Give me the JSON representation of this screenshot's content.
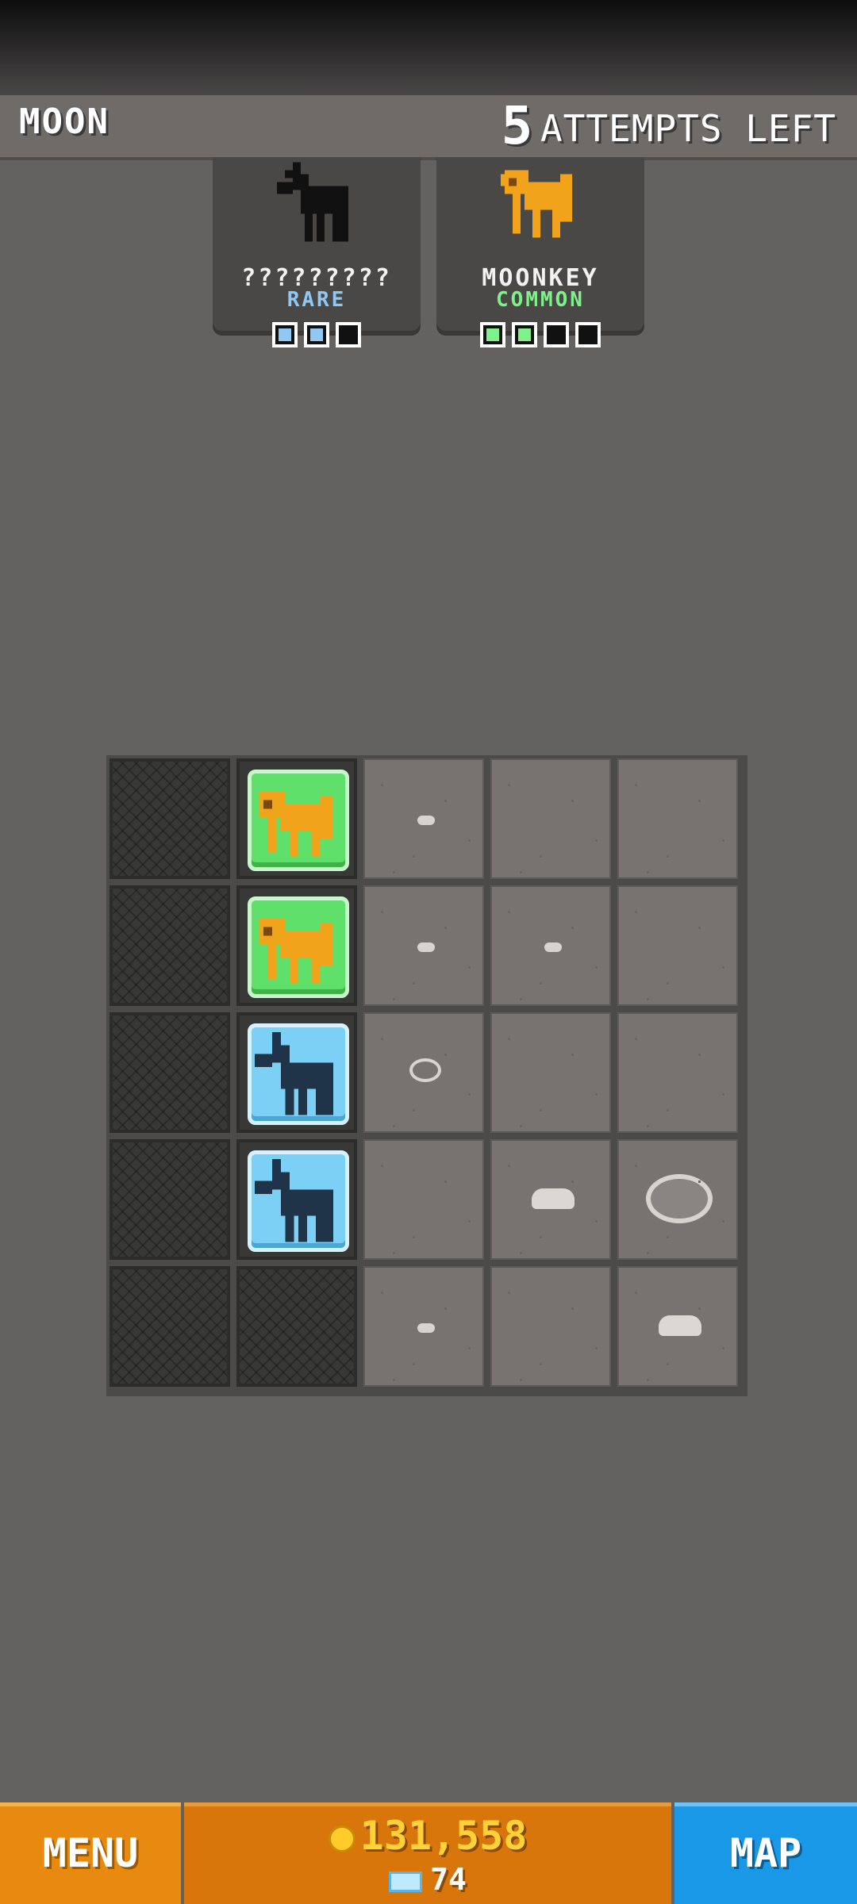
{
  "header": {
    "level_name": "MOON",
    "attempts_count": "5",
    "attempts_label": "ATTEMPTS LEFT"
  },
  "collection": {
    "cards": [
      {
        "name": "?????????",
        "rarity": "RARE",
        "rarity_color": "#8fc8f2",
        "found": 2,
        "total": 3,
        "icon": "moose-silhouette-icon"
      },
      {
        "name": "MOONKEY",
        "rarity": "COMMON",
        "rarity_color": "#7ef28a",
        "found": 2,
        "total": 4,
        "icon": "monkey-icon"
      }
    ]
  },
  "grid": {
    "rows": 5,
    "cols": 5,
    "cells": [
      [
        "dug",
        "moonkey",
        "pebble",
        "ground",
        "ground"
      ],
      [
        "dug",
        "moonkey",
        "pebble",
        "pebble",
        "ground"
      ],
      [
        "dug",
        "moose",
        "ring",
        "ground",
        "ground"
      ],
      [
        "dug",
        "moose",
        "ground",
        "rock",
        "crater"
      ],
      [
        "dug",
        "dug",
        "pebble",
        "ground",
        "rock"
      ]
    ]
  },
  "footer": {
    "menu_label": "MENU",
    "coins": "131,558",
    "gems": "74",
    "map_label": "MAP"
  },
  "colors": {
    "common_tile": "#5ee06a",
    "rare_tile": "#7dd0f5",
    "menu_button": "#e88a10",
    "map_button": "#1a98e8",
    "coin_text": "#ffd23a"
  }
}
